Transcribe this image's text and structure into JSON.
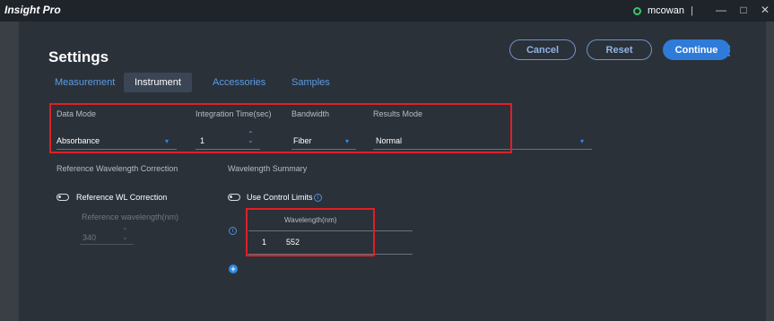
{
  "window": {
    "title": "Insight Pro",
    "user": "mcowan",
    "separator": "|",
    "minimize": "—",
    "maximize": "□",
    "close": "✕"
  },
  "header": {
    "title": "Settings",
    "kebab": "⋮"
  },
  "actions": {
    "cancel": "Cancel",
    "reset": "Reset",
    "continue": "Continue"
  },
  "tabs": [
    "Measurement",
    "Instrument",
    "Accessories",
    "Samples"
  ],
  "fields": {
    "data_mode": {
      "label": "Data Mode",
      "value": "Absorbance"
    },
    "integration_time": {
      "label": "Integration Time(sec)",
      "value": "1"
    },
    "bandwidth": {
      "label": "Bandwidth",
      "value": "Fiber"
    },
    "results_mode": {
      "label": "Results Mode",
      "value": "Normal"
    }
  },
  "reference": {
    "section_label": "Reference Wavelength Correction",
    "toggle_label": "Reference WL Correction",
    "field_label": "Reference wavelength(nm)",
    "field_value": "340"
  },
  "summary": {
    "section_label": "Wavelength Summary",
    "toggle_label": "Use Control Limits",
    "column_header": "Wavelength(nm)",
    "rows": [
      {
        "index": "1",
        "value": "552"
      }
    ]
  },
  "icons": {
    "info": "i",
    "add": "+",
    "stepper_up": "⌃",
    "stepper_down": "⌄",
    "dropdown": "▾"
  },
  "colors": {
    "accent": "#2f7bd9",
    "highlight": "#e01f26",
    "status_online": "#3ec46d"
  }
}
